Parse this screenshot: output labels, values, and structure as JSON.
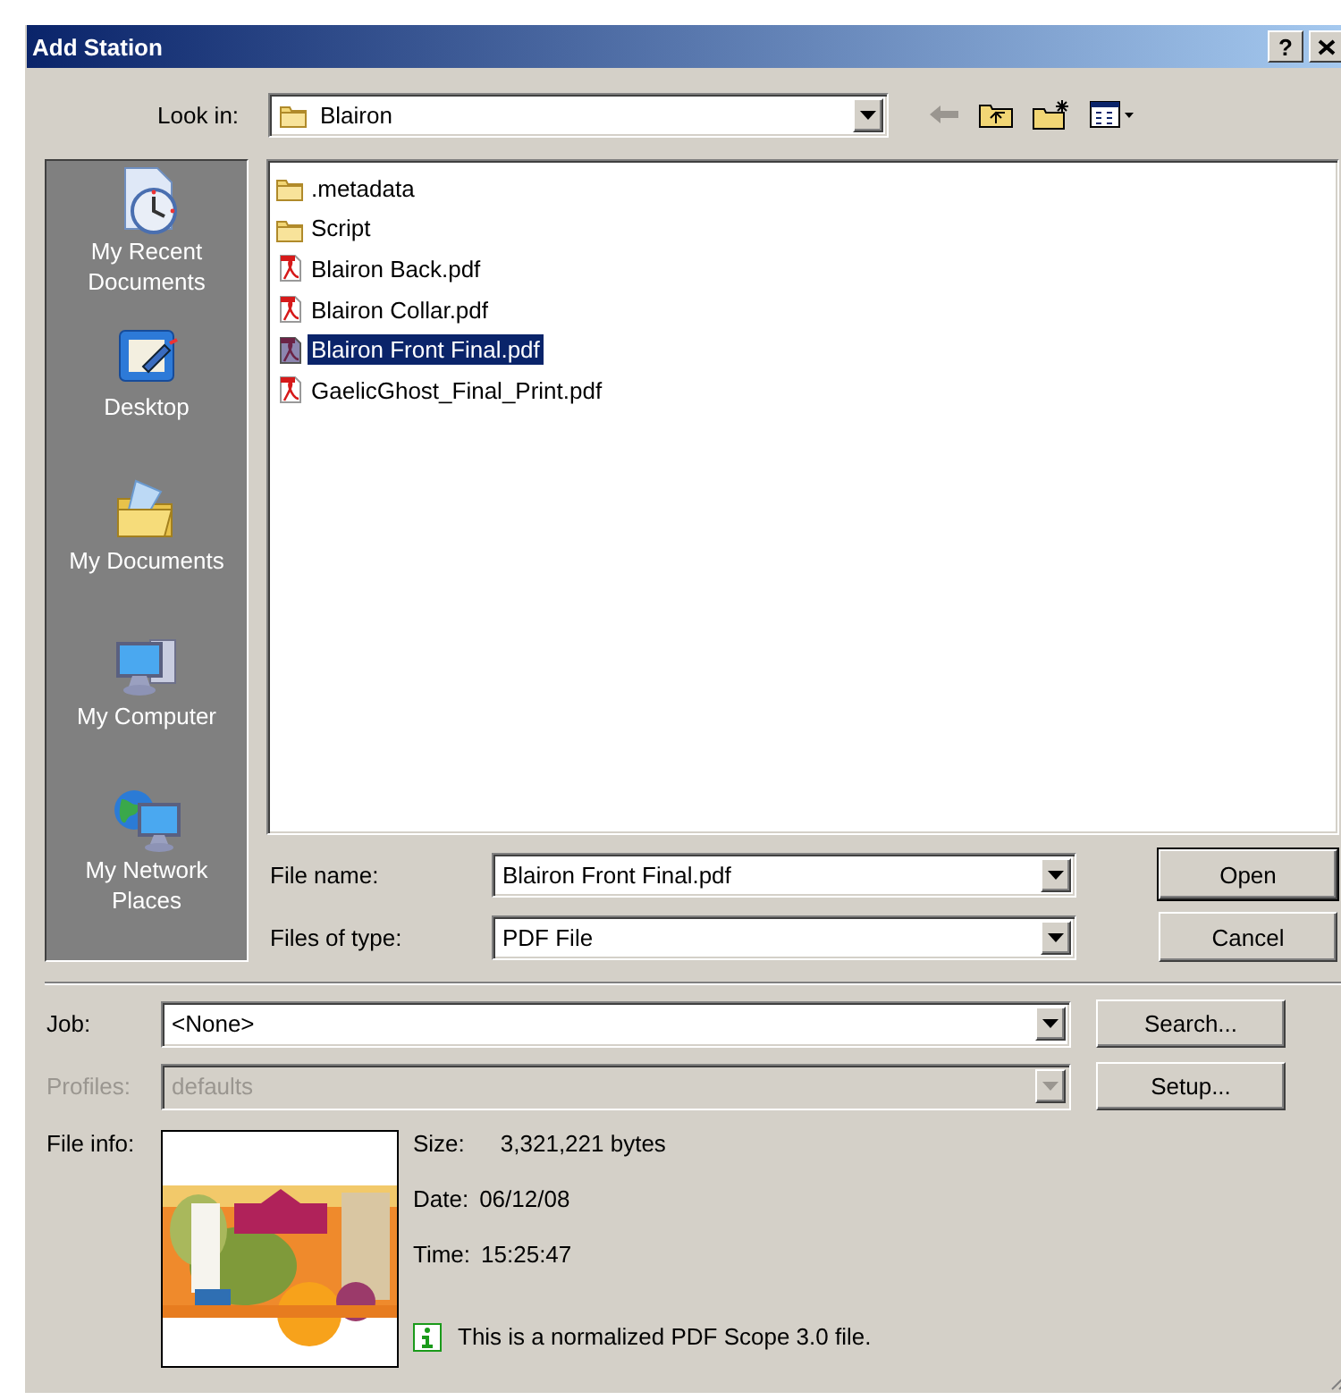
{
  "window": {
    "title": "Add Station",
    "help_button": "?"
  },
  "look_in": {
    "label": "Look in:",
    "value": "Blairon"
  },
  "places": [
    {
      "label": "My Recent Documents",
      "kind": "recent"
    },
    {
      "label": "Desktop",
      "kind": "desktop"
    },
    {
      "label": "My Documents",
      "kind": "documents"
    },
    {
      "label": "My Computer",
      "kind": "computer"
    },
    {
      "label": "My Network Places",
      "kind": "network"
    }
  ],
  "files": [
    {
      "name": ".metadata",
      "kind": "folder",
      "selected": false
    },
    {
      "name": "Script",
      "kind": "folder",
      "selected": false
    },
    {
      "name": "Blairon Back.pdf",
      "kind": "pdf",
      "selected": false
    },
    {
      "name": "Blairon Collar.pdf",
      "kind": "pdf",
      "selected": false
    },
    {
      "name": "Blairon Front Final.pdf",
      "kind": "pdf",
      "selected": true
    },
    {
      "name": "GaelicGhost_Final_Print.pdf",
      "kind": "pdf",
      "selected": false
    }
  ],
  "file_name": {
    "label": "File name:",
    "value": "Blairon Front Final.pdf"
  },
  "file_type": {
    "label": "Files of type:",
    "value": "PDF File"
  },
  "dialog_buttons": [
    {
      "label": "Open",
      "default": true
    },
    {
      "label": "Cancel",
      "default": false
    }
  ],
  "job": {
    "label": "Job:",
    "value": "<None>",
    "disabled": false,
    "button": "Search..."
  },
  "profiles": {
    "label": "Profiles:",
    "value": "defaults",
    "disabled": true,
    "button": "Setup..."
  },
  "file_info": {
    "label": "File info:",
    "size_label": "Size:",
    "size": "3,321,221 bytes",
    "date_label": "Date:",
    "date": "06/12/08",
    "time_label": "Time:",
    "time": "15:25:47",
    "note": "This is a normalized PDF Scope 3.0 file."
  }
}
